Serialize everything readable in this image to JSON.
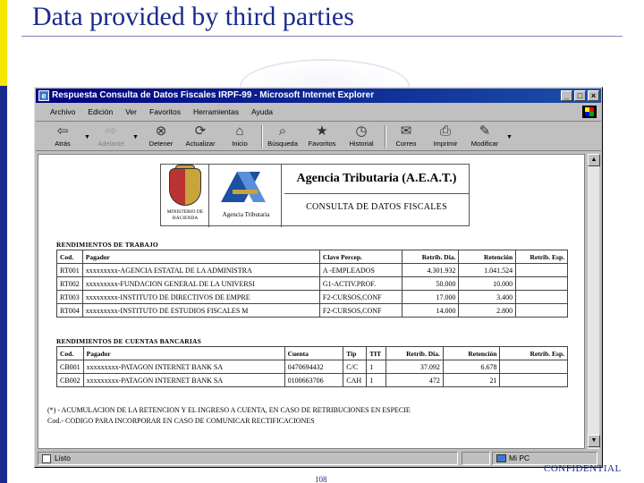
{
  "slide": {
    "title": "Data provided by third parties",
    "page_number": "108",
    "footer": "CONFIDENTIAL"
  },
  "window": {
    "title": "Respuesta Consulta de Datos Fiscales IRPF-99 - Microsoft Internet Explorer",
    "buttons": {
      "minimize": "_",
      "maximize": "□",
      "close": "×"
    }
  },
  "menu": [
    "Archivo",
    "Edición",
    "Ver",
    "Favoritos",
    "Herramientas",
    "Ayuda"
  ],
  "toolbar": [
    {
      "label": "Atrás",
      "icon": "⇦"
    },
    {
      "label": "Adelante",
      "icon": "⇨"
    },
    {
      "label": "Detener",
      "icon": "⊗"
    },
    {
      "label": "Actualizar",
      "icon": "⟳"
    },
    {
      "label": "Inicio",
      "icon": "⌂"
    },
    {
      "label": "Búsqueda",
      "icon": "⌕"
    },
    {
      "label": "Favoritos",
      "icon": "★"
    },
    {
      "label": "Historial",
      "icon": "◷"
    },
    {
      "label": "Correo",
      "icon": "✉"
    },
    {
      "label": "Imprimir",
      "icon": "⎙"
    },
    {
      "label": "Modificar",
      "icon": "✎"
    }
  ],
  "status": {
    "left": "Listo",
    "right": "Mi PC"
  },
  "header": {
    "ministerio": "MINISTERIO DE HACIENDA",
    "aeat_label": "Agencia Tributaria",
    "agency_title": "Agencia Tributaria (A.E.A.T.)",
    "consulta": "CONSULTA DE DATOS FISCALES"
  },
  "trabajo": {
    "title": "RENDIMIENTOS DE TRABAJO",
    "columns": [
      "Cod.",
      "Pagador",
      "Clave Percep.",
      "Retrib. Dia.",
      "Retención",
      "Retrib. Esp."
    ],
    "rows": [
      [
        "RT001",
        "xxxxxxxxx-AGENCIA ESTATAL DE LA ADMINISTRA",
        "A -EMPLEADOS",
        "4.301.932",
        "1.041.524",
        ""
      ],
      [
        "RT002",
        "xxxxxxxxx-FUNDACION GENERAL DE LA UNIVERSI",
        "G1-ACTIV.PROF.",
        "50.000",
        "10.000",
        ""
      ],
      [
        "RT003",
        "xxxxxxxxx-INSTITUTO DE DIRECTIVOS DE EMPRE",
        "F2-CURSOS,CONF",
        "17.000",
        "3.400",
        ""
      ],
      [
        "RT004",
        "xxxxxxxxx-INSTITUTO DE ESTUDIOS FISCALES M",
        "F2-CURSOS,CONF",
        "14.000",
        "2.800",
        ""
      ]
    ]
  },
  "bancarias": {
    "title": "RENDIMIENTOS DE CUENTAS BANCARIAS",
    "columns": [
      "Cod.",
      "Pagador",
      "Cuenta",
      "Tip",
      "TIT",
      "Retrib. Dia.",
      "Retención",
      "Retrib. Esp."
    ],
    "rows": [
      [
        "CB001",
        "xxxxxxxxx-PATAGON INTERNET BANK SA",
        "0470694432",
        "C/C",
        "1",
        "37.092",
        "6.678",
        ""
      ],
      [
        "CB002",
        "xxxxxxxxx-PATAGON INTERNET BANK SA",
        "0100663706",
        "CAH",
        "1",
        "472",
        "21",
        ""
      ]
    ]
  },
  "notes": [
    "(*) - ACUMULACION DE LA RETENCION Y EL INGRESO A CUENTA, EN CASO DE RETRIBUCIONES EN ESPECIE",
    "Cod.- CODIGO PARA INCORPORAR EN CASO DE COMUNICAR RECTIFICACIONES"
  ]
}
